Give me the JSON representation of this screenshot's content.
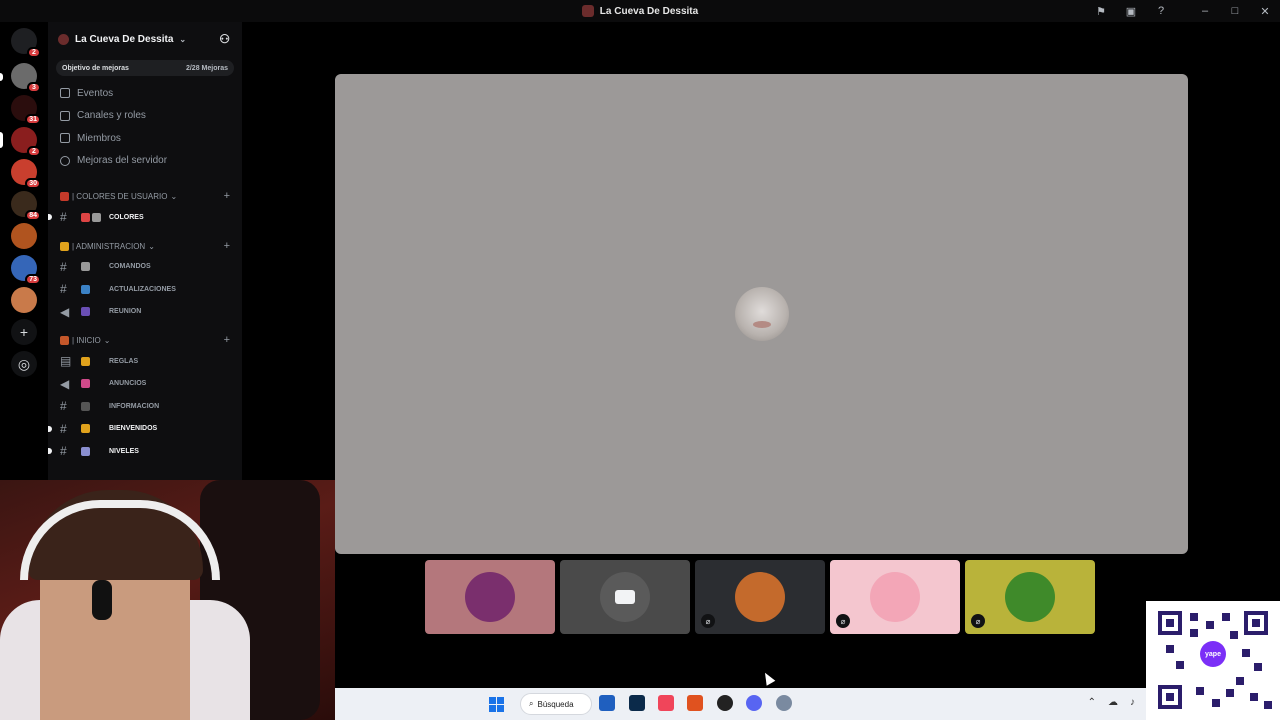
{
  "window": {
    "title": "La Cueva De Dessita"
  },
  "server": {
    "name": "La Cueva De Dessita",
    "boost_goal_label": "Objetivo de mejoras",
    "boost_goal_progress": "2/28 Mejoras"
  },
  "rail_badges": [
    "2",
    "3",
    "31",
    "2",
    "30",
    "84",
    "73"
  ],
  "nav": [
    {
      "label": "Eventos",
      "icon": "calendar-icon"
    },
    {
      "label": "Canales y roles",
      "icon": "channels-icon"
    },
    {
      "label": "Miembros",
      "icon": "members-icon"
    },
    {
      "label": "Mejoras del servidor",
      "icon": "boost-icon"
    }
  ],
  "categories": [
    {
      "name": "| COLORES DE USUARIO",
      "channels": [
        {
          "name": "COLORES",
          "unread": true
        }
      ]
    },
    {
      "name": "| ADMINISTRACION",
      "channels": [
        {
          "name": "COMANDOS",
          "unread": false
        },
        {
          "name": "ACTUALIZACIONES",
          "unread": false
        },
        {
          "name": "REUNION",
          "unread": false
        }
      ]
    },
    {
      "name": "| INICIO",
      "channels": [
        {
          "name": "REGLAS",
          "unread": false
        },
        {
          "name": "ANUNCIOS",
          "unread": false
        },
        {
          "name": "INFORMACION",
          "unread": false
        },
        {
          "name": "BIENVENIDOS",
          "unread": true
        },
        {
          "name": "NIVELES",
          "unread": true
        }
      ]
    }
  ],
  "participants": [
    {
      "bg": "#b4777c",
      "avatar": "#7a2f6d",
      "muted": false
    },
    {
      "bg": "#4a4a4a",
      "avatar": "#5a5a5a",
      "muted": false,
      "camera_off": true
    },
    {
      "bg": "#2b2d31",
      "avatar": "#c46a2c",
      "muted": true
    },
    {
      "bg": "#f4c6cf",
      "avatar": "#f3a6b7",
      "muted": true
    },
    {
      "bg": "#b9b33a",
      "avatar": "#3f8a2a",
      "muted": true
    }
  ],
  "taskbar": {
    "search_label": "Búsqueda"
  },
  "qr_label": "yape",
  "colors": {
    "stage_bg": "#9c9998",
    "sidebar_bg": "#0e0e10",
    "badge": "#d83c3e",
    "taskbar": "#edf0f5"
  }
}
